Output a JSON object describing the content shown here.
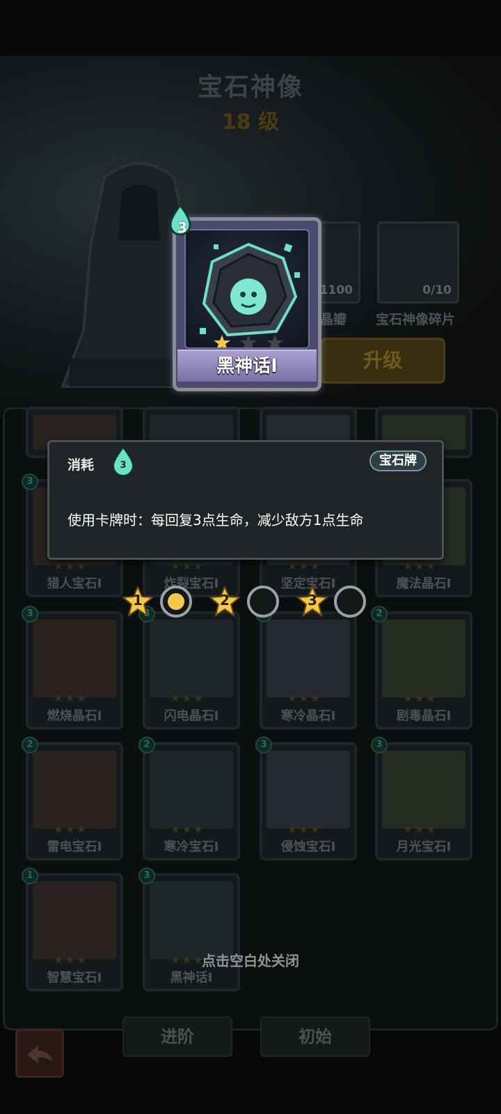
{
  "header": {
    "title": "宝石神像",
    "level": "18 级"
  },
  "materials": [
    {
      "count": "1100",
      "name": "晶瓣"
    },
    {
      "count": "0/10",
      "name": "宝石神像碎片"
    }
  ],
  "upgrade_label": "升级",
  "featured_card": {
    "name": "黑神话I",
    "cost": "3",
    "stars_filled": 1,
    "stars_total": 3
  },
  "tooltip": {
    "cost_label": "消耗",
    "cost_value": "3",
    "tag": "宝石牌",
    "description": "使用卡牌时：每回复3点生命，减少敌方1点生命"
  },
  "star_levels": [
    {
      "label": "1",
      "selected": true
    },
    {
      "label": "2",
      "selected": false
    },
    {
      "label": "3",
      "selected": false
    }
  ],
  "cards": [
    {
      "name": "猎人宝石I",
      "cost": "3"
    },
    {
      "name": "炸裂宝石I",
      "cost": ""
    },
    {
      "name": "坚定宝石I",
      "cost": ""
    },
    {
      "name": "魔法晶石I",
      "cost": ""
    },
    {
      "name": "燃烧晶石I",
      "cost": "3"
    },
    {
      "name": "闪电晶石I",
      "cost": "3"
    },
    {
      "name": "寒冷晶石I",
      "cost": "2"
    },
    {
      "name": "剧毒晶石I",
      "cost": "2"
    },
    {
      "name": "雷电宝石I",
      "cost": "2"
    },
    {
      "name": "寒冷宝石I",
      "cost": "2"
    },
    {
      "name": "侵蚀宝石I",
      "cost": "3"
    },
    {
      "name": "月光宝石I",
      "cost": "3"
    },
    {
      "name": "智慧宝石I",
      "cost": "1"
    },
    {
      "name": "黑神话I",
      "cost": "3"
    }
  ],
  "close_hint": "点击空白处关闭",
  "bottom": {
    "advance_label": "进阶",
    "reset_label": "初始"
  },
  "colors": {
    "accent_gold": "#f5c84a",
    "cost_teal": "#6fe0c8",
    "ribbon_purple": "#8f86bb"
  },
  "icons": {
    "cost": "flame-drop-icon",
    "back": "back-arrow-icon",
    "star": "star-icon"
  }
}
